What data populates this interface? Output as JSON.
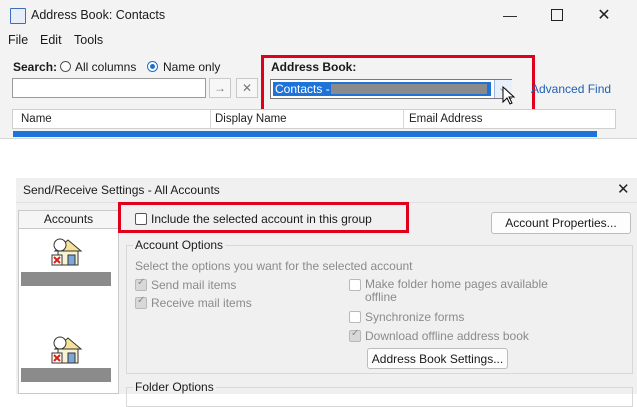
{
  "window1": {
    "title": "Address Book: Contacts",
    "menu": [
      "File",
      "Edit",
      "Tools"
    ],
    "search": {
      "label": "Search:",
      "options": [
        "All columns",
        "Name only"
      ],
      "selected": "Name only",
      "value": ""
    },
    "address_book": {
      "label": "Address Book:",
      "selected": "Contacts - "
    },
    "advanced_find": "Advanced Find",
    "columns": [
      "Name",
      "Display Name",
      "Email Address"
    ]
  },
  "window2": {
    "title": "Send/Receive Settings - All Accounts",
    "accounts_tab": "Accounts",
    "include_checkbox": "Include the selected account in this group",
    "account_properties_button": "Account Properties...",
    "account_options": {
      "legend": "Account Options",
      "hint": "Select the options you want for the selected account",
      "left": [
        "Send mail items",
        "Receive mail items"
      ],
      "right": [
        "Make folder home pages available offline",
        "Synchronize forms",
        "Download offline address book"
      ]
    },
    "address_book_settings_button": "Address Book Settings...",
    "folder_options": "Folder Options"
  },
  "colors": {
    "accent": "#1f6fcf",
    "highlight": "#e0001b",
    "selection": "#1e73d8"
  }
}
